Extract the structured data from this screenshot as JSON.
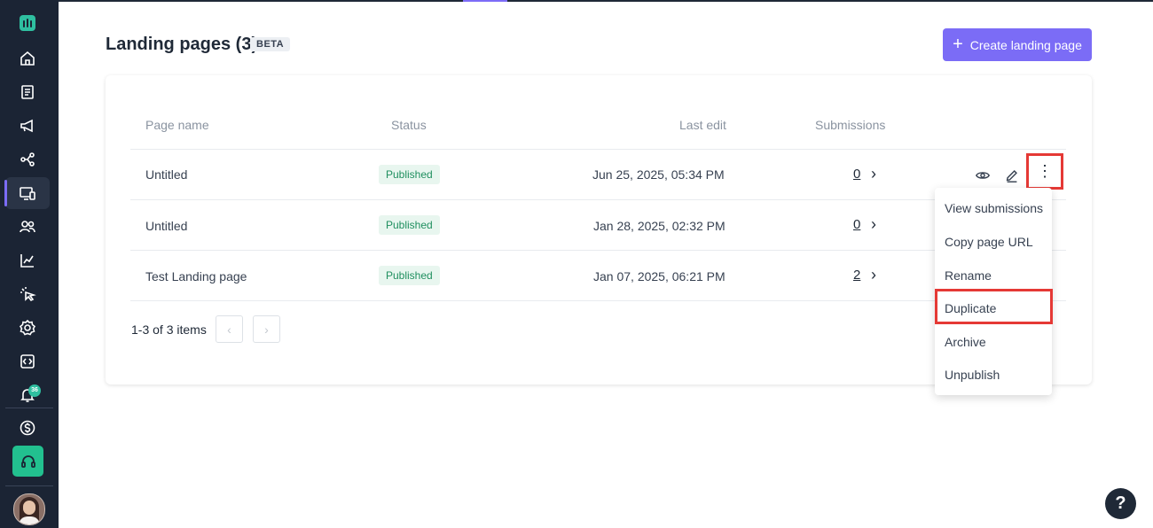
{
  "header": {
    "title": "Landing pages (3)",
    "badge": "BETA",
    "create_button": "Create landing page"
  },
  "table": {
    "columns": [
      "Page name",
      "Status",
      "Last edit",
      "Submissions"
    ],
    "rows": [
      {
        "name": "Untitled",
        "status": "Published",
        "last_edit": "Jun 25, 2025, 05:34 PM",
        "submissions": "0"
      },
      {
        "name": "Untitled",
        "status": "Published",
        "last_edit": "Jan 28, 2025, 02:32 PM",
        "submissions": "0"
      },
      {
        "name": "Test Landing page",
        "status": "Published",
        "last_edit": "Jan 07, 2025, 06:21 PM",
        "submissions": "2"
      }
    ]
  },
  "pagination": {
    "label": "1-3 of 3 items",
    "prev": "‹",
    "next": "›"
  },
  "row_menu": {
    "items": [
      "View submissions",
      "Copy page URL",
      "Rename",
      "Duplicate",
      "Archive",
      "Unpublish"
    ],
    "highlighted": "Duplicate"
  },
  "sidebar": {
    "notification_count": "36",
    "icons": [
      "home-icon",
      "document-icon",
      "megaphone-icon",
      "workflow-icon",
      "landing-page-icon",
      "contacts-icon",
      "analytics-icon",
      "click-icon",
      "settings-icon",
      "code-icon",
      "bell-icon",
      "billing-icon",
      "headset-icon"
    ]
  },
  "help": {
    "label": "?"
  },
  "colors": {
    "sidebar_bg": "#1b2434",
    "accent": "#7b6cf6",
    "published": "#1f8f5f",
    "highlight": "#e53935"
  }
}
